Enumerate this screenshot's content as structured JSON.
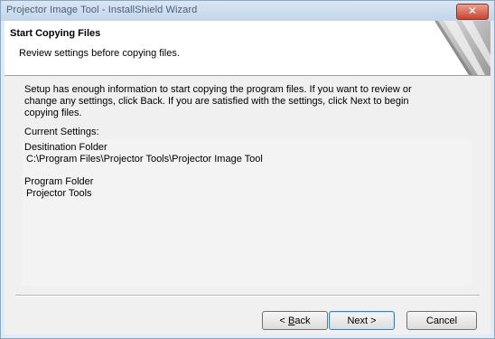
{
  "window": {
    "title": "Projector Image Tool - InstallShield Wizard",
    "close_symbol": "✕"
  },
  "header": {
    "title": "Start Copying Files",
    "subtitle": "Review settings before copying files."
  },
  "body": {
    "line1": "Setup has enough information to start copying the program files.  If you want to review or",
    "line2": "change any settings, click Back.  If you are satisfied with the settings, click Next to begin",
    "line3": "copying files.",
    "current_settings_label": "Current Settings:"
  },
  "settings": {
    "dest_label": "Desitination Folder",
    "dest_value": "C:\\Program Files\\Projector Tools\\Projector Image Tool",
    "program_label": "Program Folder",
    "program_value": "Projector Tools"
  },
  "buttons": {
    "back_prefix": "< ",
    "back_mnemonic": "B",
    "back_rest": "ack",
    "next_label": "Next >",
    "cancel_label": "Cancel"
  },
  "colors": {
    "accent": "#3c7fb1",
    "close": "#c7452f"
  },
  "icons": {
    "header_graphic": "installshield-banner-graphic",
    "close": "close-icon"
  }
}
